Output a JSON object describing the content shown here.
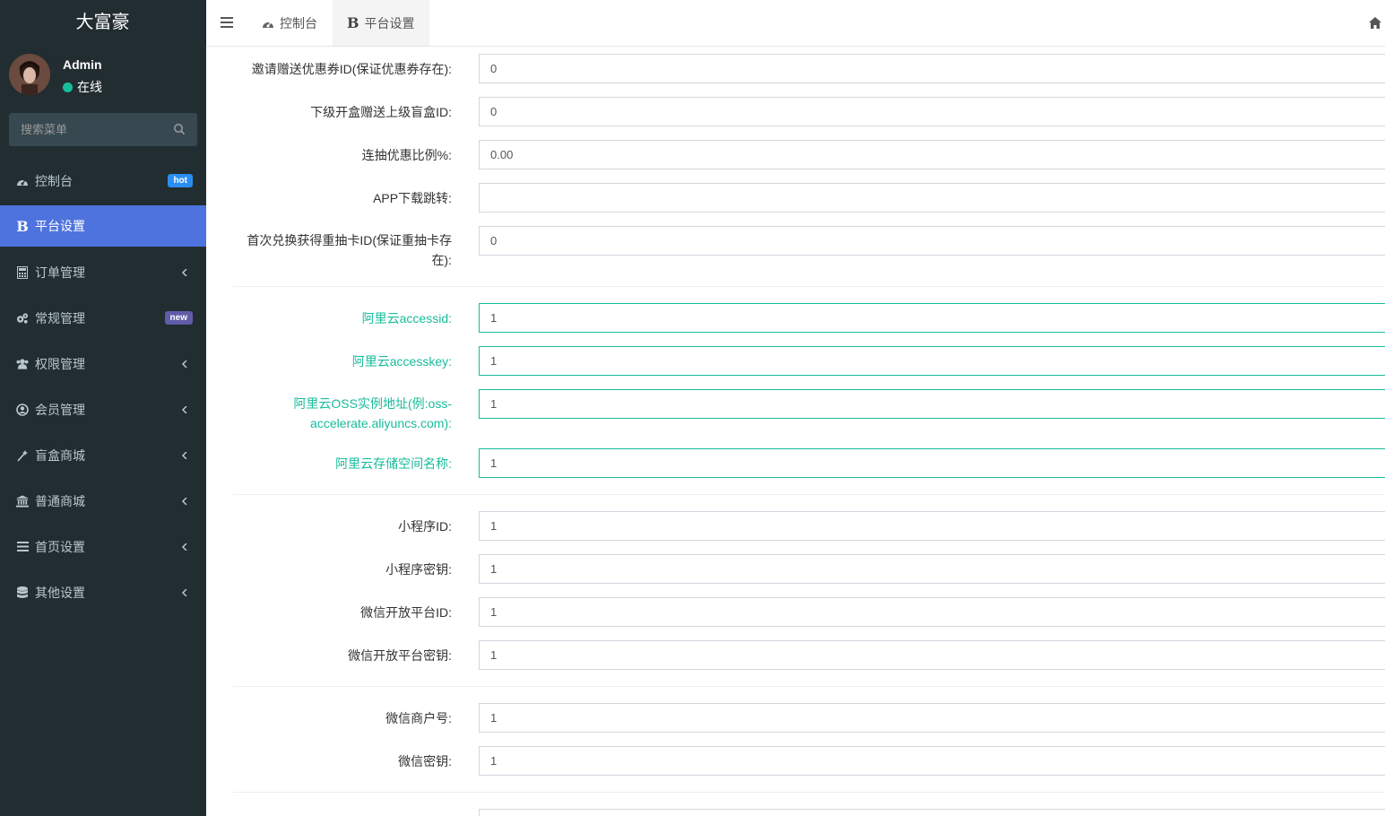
{
  "brand": "大富豪",
  "user": {
    "name": "Admin",
    "status": "在线"
  },
  "search": {
    "placeholder": "搜索菜单"
  },
  "menu": [
    {
      "label": "控制台",
      "icon": "dashboard-icon",
      "badge": "hot"
    },
    {
      "label": "平台设置",
      "icon": "bold-b-icon",
      "icon_text": "B",
      "active": true
    },
    {
      "label": "订单管理",
      "icon": "calculator-icon",
      "chevron": true
    },
    {
      "label": "常规管理",
      "icon": "cogs-icon",
      "badge": "new"
    },
    {
      "label": "权限管理",
      "icon": "group-icon",
      "chevron": true
    },
    {
      "label": "会员管理",
      "icon": "user-circle-icon",
      "chevron": true
    },
    {
      "label": "盲盒商城",
      "icon": "magic-icon",
      "chevron": true
    },
    {
      "label": "普通商城",
      "icon": "bank-icon",
      "chevron": true
    },
    {
      "label": "首页设置",
      "icon": "list-icon",
      "chevron": true
    },
    {
      "label": "其他设置",
      "icon": "database-icon",
      "chevron": true
    }
  ],
  "tabs": [
    {
      "label": "控制台",
      "icon": "dashboard-icon"
    },
    {
      "label": "平台设置",
      "icon": "bold-b-icon",
      "icon_text": "B",
      "active": true
    }
  ],
  "form": {
    "invite_coupon": {
      "label": "邀请赠送优惠券ID(保证优惠券存在):",
      "value": "0"
    },
    "sub_box": {
      "label": "下级开盒赠送上级盲盒ID:",
      "value": "0"
    },
    "draw_discount": {
      "label": "连抽优惠比例%:",
      "value": "0.00"
    },
    "app_download": {
      "label": "APP下载跳转:",
      "value": ""
    },
    "first_redeem_line1": "首次兑换获得重抽卡ID(保证重抽卡存",
    "first_redeem_line2": "在):",
    "first_redeem_value": "0",
    "ali_accessid": {
      "label": "阿里云accessid:",
      "value": "1"
    },
    "ali_accesskey": {
      "label": "阿里云accesskey:",
      "value": "1"
    },
    "ali_oss_line1": "阿里云OSS实例地址(例:oss-",
    "ali_oss_line2": "accelerate.aliyuncs.com):",
    "ali_oss_value": "1",
    "ali_bucket": {
      "label": "阿里云存储空间名称:",
      "value": "1"
    },
    "mini_id": {
      "label": "小程序ID:",
      "value": "1"
    },
    "mini_secret": {
      "label": "小程序密钥:",
      "value": "1"
    },
    "wx_open_id": {
      "label": "微信开放平台ID:",
      "value": "1"
    },
    "wx_open_secret": {
      "label": "微信开放平台密钥:",
      "value": "1"
    },
    "wx_mch": {
      "label": "微信商户号:",
      "value": "1"
    },
    "wx_key": {
      "label": "微信密钥:",
      "value": "1"
    }
  },
  "colors": {
    "sidebar": "#222d32",
    "active": "#4e73df",
    "accent_green": "#18bc9c"
  }
}
